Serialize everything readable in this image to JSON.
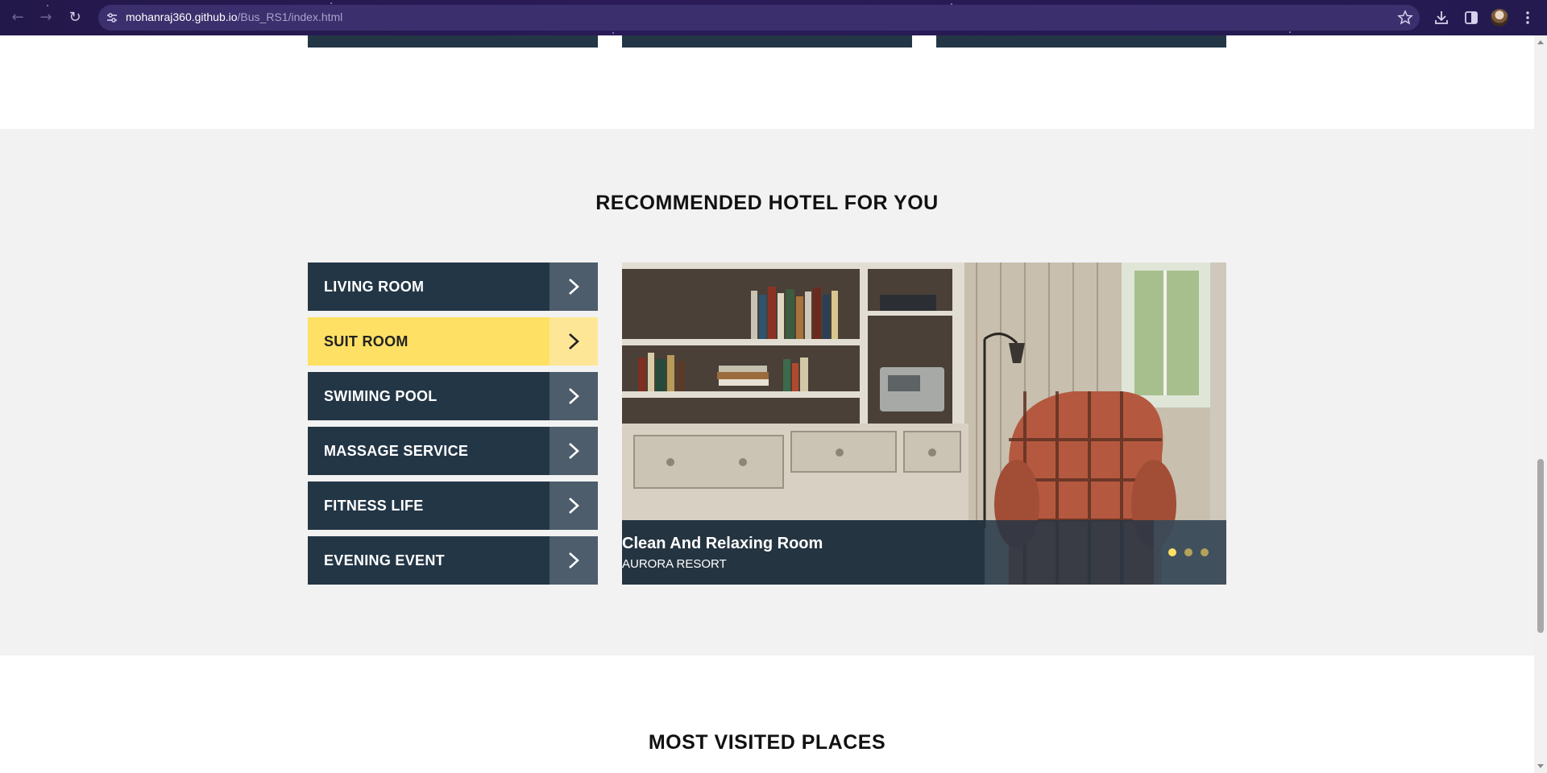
{
  "browser": {
    "url_host": "mohanraj360.github.io",
    "url_path": "/Bus_RS1/index.html",
    "icons": [
      "back-icon",
      "forward-icon",
      "reload-icon",
      "site-info-icon",
      "bookmark-star-icon",
      "download-icon",
      "side-panel-icon",
      "profile-avatar",
      "menu-icon"
    ]
  },
  "recommended": {
    "title": "RECOMMENDED HOTEL FOR YOU",
    "menu": [
      {
        "label": "LIVING ROOM",
        "active": false
      },
      {
        "label": "SUIT ROOM",
        "active": true
      },
      {
        "label": "SWIMING POOL",
        "active": false
      },
      {
        "label": "MASSAGE SERVICE",
        "active": false
      },
      {
        "label": "FITNESS LIFE",
        "active": false
      },
      {
        "label": "EVENING EVENT",
        "active": false
      }
    ],
    "slide": {
      "title": "Clean And Relaxing Room",
      "subtitle": "AURORA RESORT",
      "dots_count": 3,
      "active_dot": 0
    }
  },
  "next_section": {
    "title": "MOST VISITED PLACES"
  },
  "colors": {
    "navy": "#233646",
    "accent_yellow": "#fde064",
    "section_bg": "#f2f2f2"
  }
}
